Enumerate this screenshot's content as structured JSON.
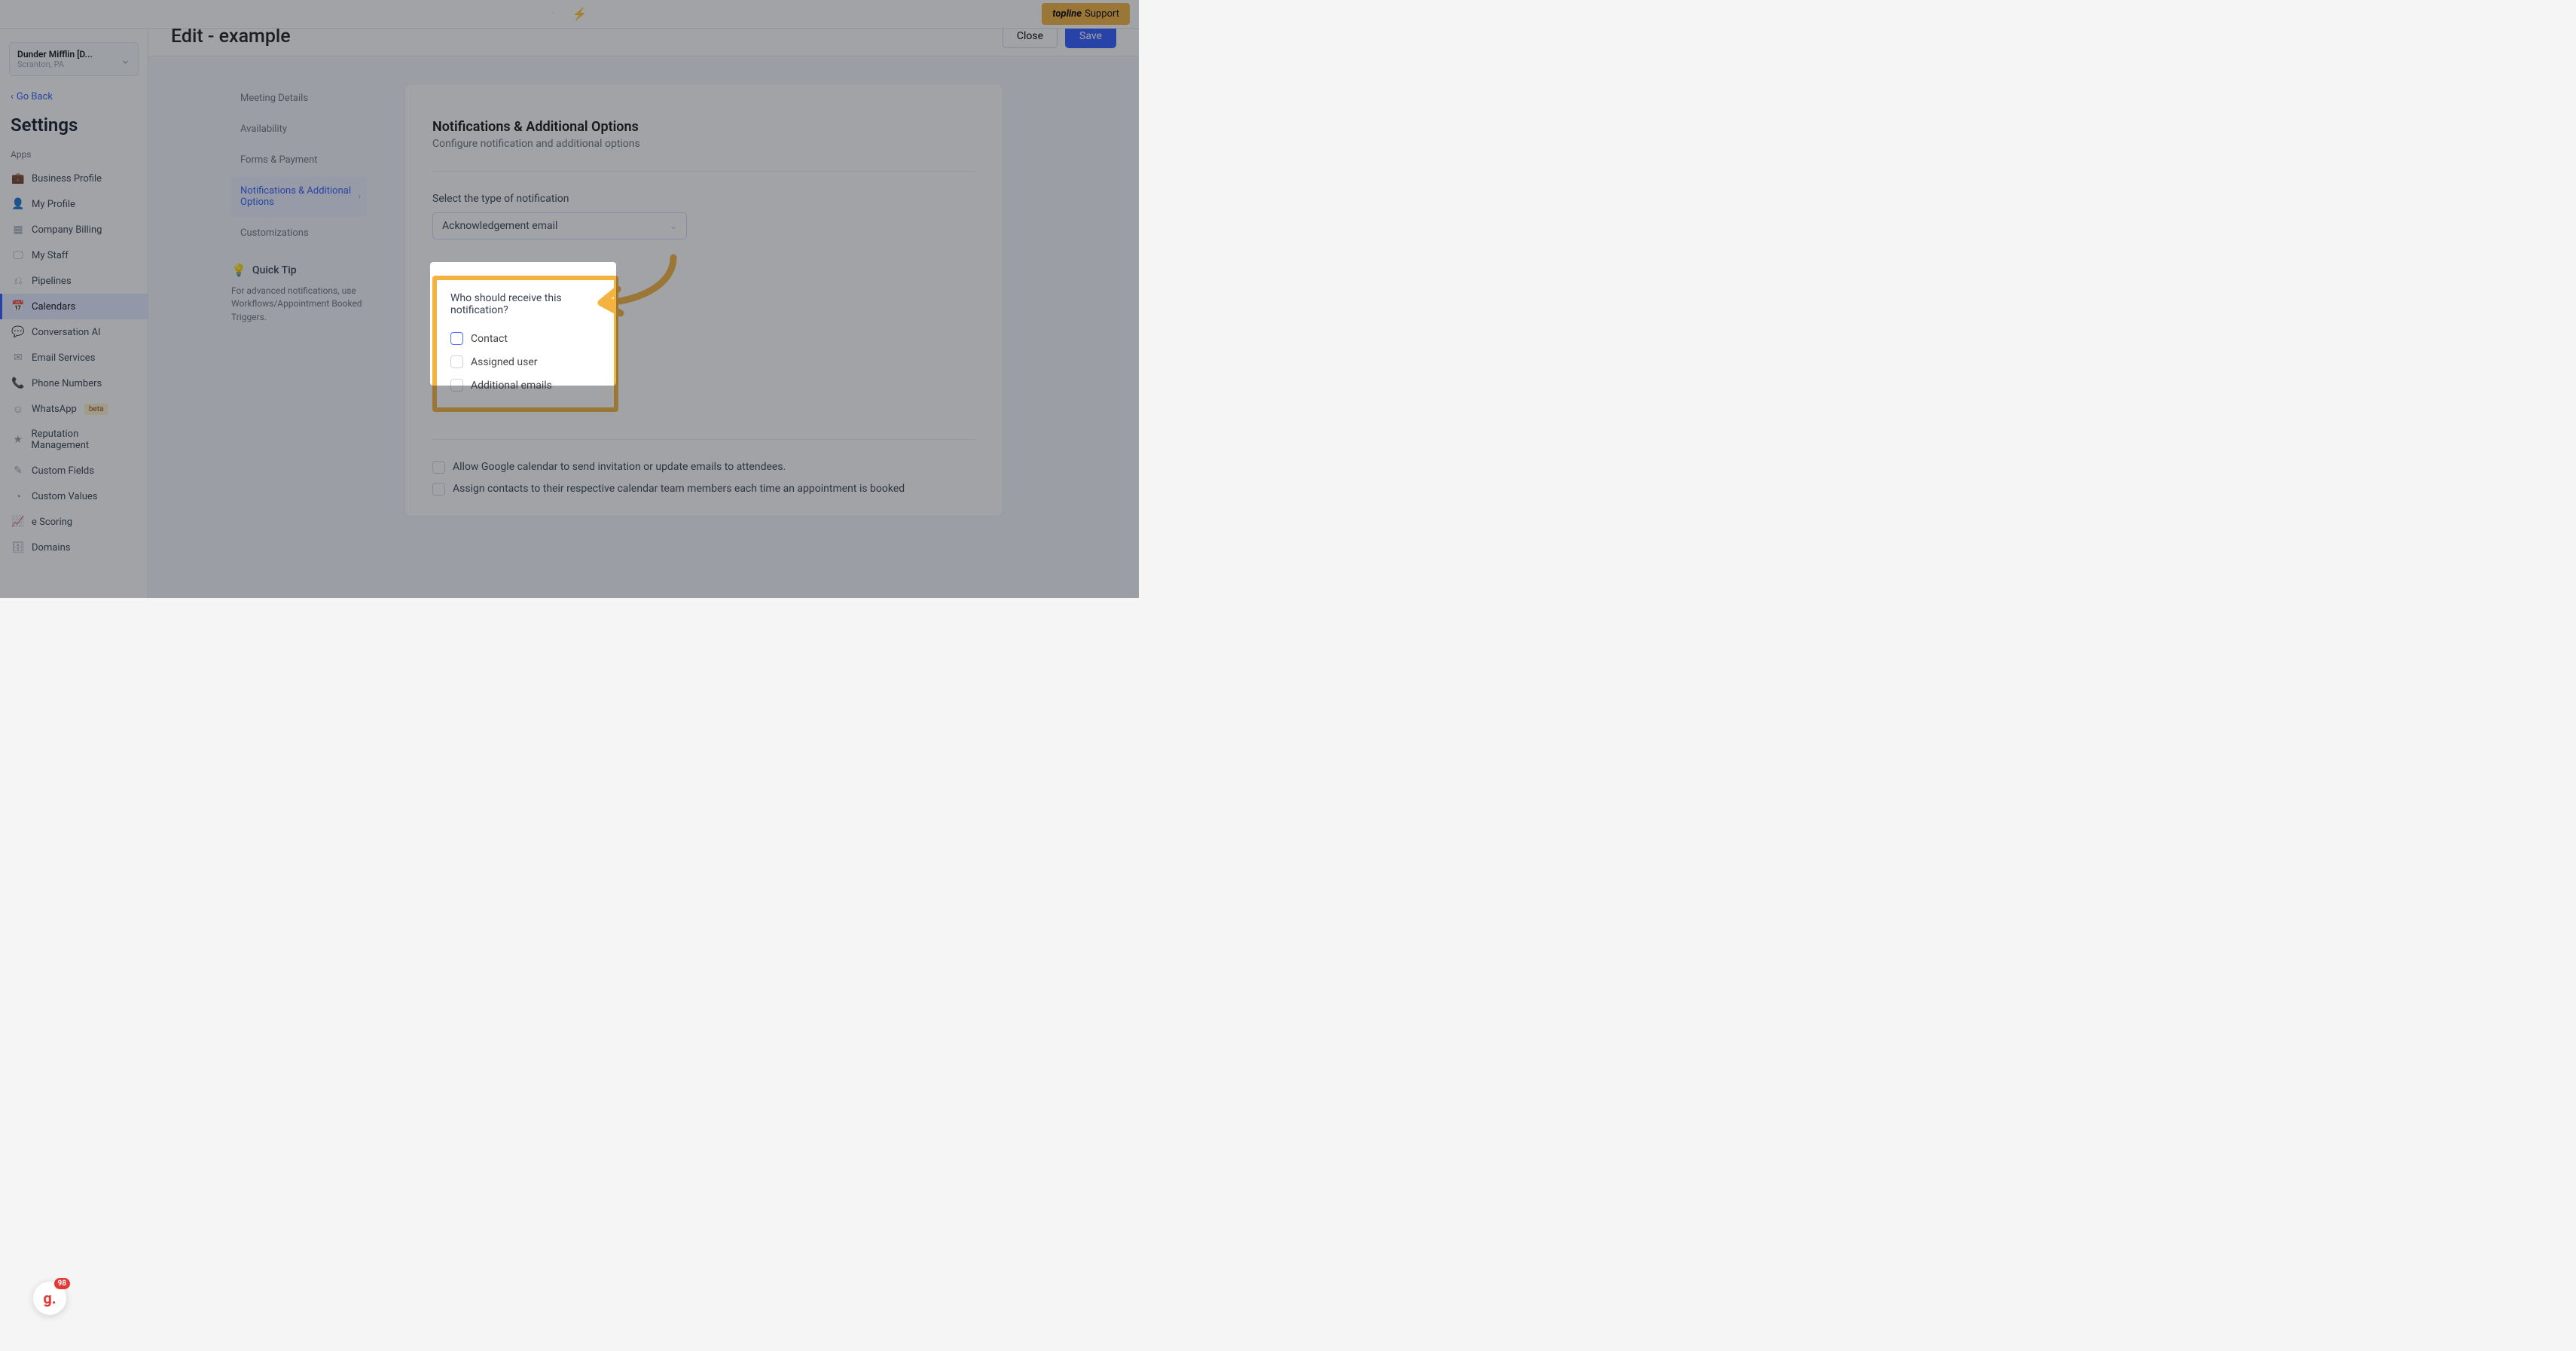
{
  "topbar": {
    "support_brand": "topline",
    "support_label": "Support"
  },
  "sidebar": {
    "location_name": "Dunder Mifflin [D...",
    "location_sub": "Scranton, PA",
    "go_back": "Go Back",
    "settings_heading": "Settings",
    "group_label": "Apps",
    "beta": "beta",
    "items": [
      {
        "label": "Business Profile",
        "icon": "💼"
      },
      {
        "label": "My Profile",
        "icon": "👤"
      },
      {
        "label": "Company Billing",
        "icon": "▦"
      },
      {
        "label": "My Staff",
        "icon": "🖵"
      },
      {
        "label": "Pipelines",
        "icon": "⎌"
      },
      {
        "label": "Calendars",
        "icon": "📅",
        "active": true
      },
      {
        "label": "Conversation AI",
        "icon": "💬"
      },
      {
        "label": "Email Services",
        "icon": "✉"
      },
      {
        "label": "Phone Numbers",
        "icon": "📞"
      },
      {
        "label": "WhatsApp",
        "icon": "☺",
        "beta": true
      },
      {
        "label": "Reputation Management",
        "icon": "★"
      },
      {
        "label": "Custom Fields",
        "icon": "✎"
      },
      {
        "label": "Custom Values",
        "icon": "◔"
      },
      {
        "label": "e Scoring",
        "icon": "📈"
      },
      {
        "label": "Domains",
        "icon": "🗄"
      }
    ]
  },
  "page": {
    "title": "Edit - example",
    "close": "Close",
    "save": "Save"
  },
  "steps": [
    {
      "label": "Meeting Details"
    },
    {
      "label": "Availability"
    },
    {
      "label": "Forms & Payment"
    },
    {
      "label": "Notifications & Additional Options",
      "active": true
    },
    {
      "label": "Customizations"
    }
  ],
  "quick_tip": {
    "heading": "Quick Tip",
    "body": "For advanced notifications, use Workflows/Appointment Booked Triggers."
  },
  "panel": {
    "heading": "Notifications & Additional Options",
    "sub": "Configure notification and additional options",
    "select_label": "Select the type of notification",
    "select_value": "Acknowledgement email",
    "who_q": "Who should receive this notification?",
    "checkbox_contact": "Contact",
    "checkbox_assigned": "Assigned user",
    "checkbox_additional": "Additional emails",
    "opt1": "Allow Google calendar to send invitation or update emails to attendees.",
    "opt2": "Assign contacts to their respective calendar team members each time an appointment is booked"
  },
  "floating_badge": {
    "letter": "g.",
    "count": "98"
  }
}
